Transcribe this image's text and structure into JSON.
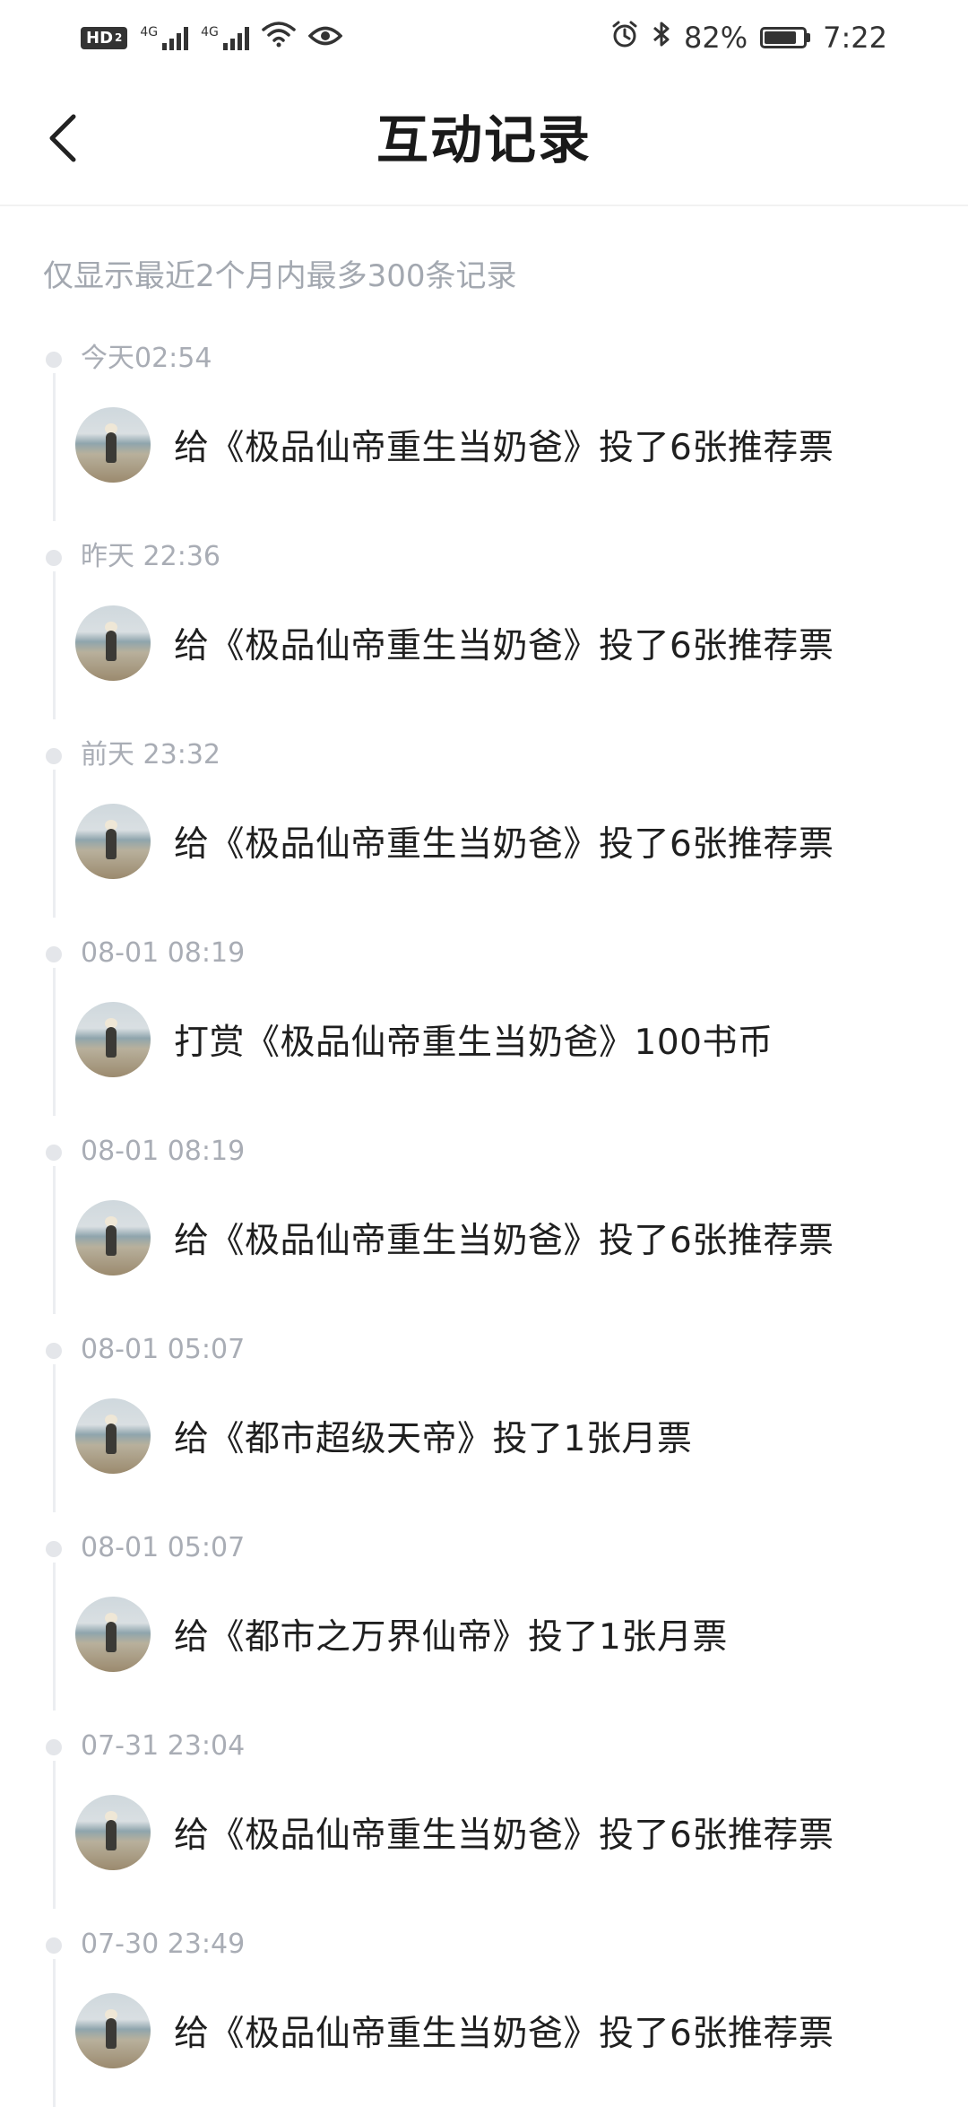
{
  "status_bar": {
    "hd": "HD",
    "hd_sub": "2",
    "net1": "4G",
    "net2": "4G",
    "battery_percent": "82%",
    "battery_level": 0.82,
    "time": "7:22"
  },
  "header": {
    "title": "互动记录"
  },
  "notice": "仅显示最近2个月内最多300条记录",
  "records": [
    {
      "time": "今天02:54",
      "text": "给《极品仙帝重生当奶爸》投了6张推荐票"
    },
    {
      "time": "昨天 22:36",
      "text": "给《极品仙帝重生当奶爸》投了6张推荐票"
    },
    {
      "time": "前天 23:32",
      "text": "给《极品仙帝重生当奶爸》投了6张推荐票"
    },
    {
      "time": "08-01 08:19",
      "text": "打赏《极品仙帝重生当奶爸》100书币"
    },
    {
      "time": "08-01 08:19",
      "text": "给《极品仙帝重生当奶爸》投了6张推荐票"
    },
    {
      "time": "08-01 05:07",
      "text": "给《都市超级天帝》投了1张月票"
    },
    {
      "time": "08-01 05:07",
      "text": "给《都市之万界仙帝》投了1张月票"
    },
    {
      "time": "07-31 23:04",
      "text": "给《极品仙帝重生当奶爸》投了6张推荐票"
    },
    {
      "time": "07-30 23:49",
      "text": "给《极品仙帝重生当奶爸》投了6张推荐票"
    }
  ]
}
